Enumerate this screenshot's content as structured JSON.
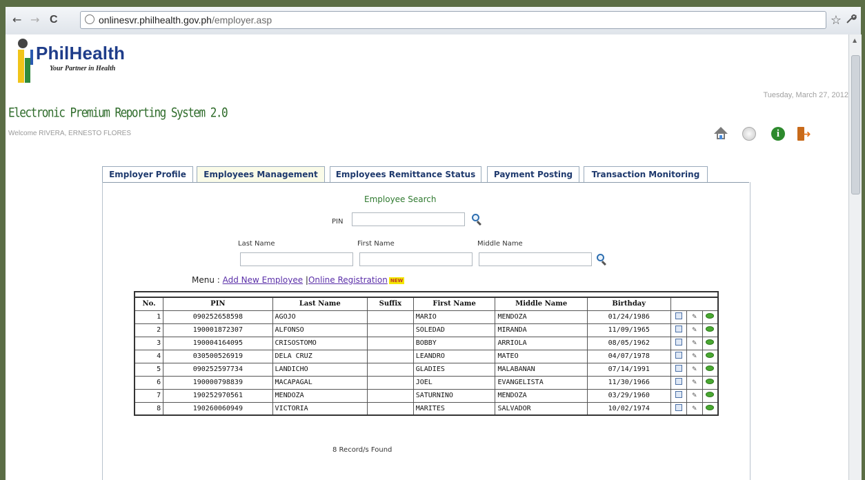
{
  "browser": {
    "back": "←",
    "forward": "→",
    "reload": "C",
    "url_host": "onlinesvr.philhealth.gov.ph",
    "url_path": "/employer.asp",
    "star": "☆",
    "wrench": "🔧"
  },
  "header": {
    "logo_name": "PhilHealth",
    "logo_tagline": "Your Partner in Health",
    "date": "Tuesday, March 27, 2012",
    "system_title": "Electronic Premium Reporting System 2.0",
    "welcome": "Welcome RIVERA, ERNESTO FLORES"
  },
  "toolbar_icons": [
    "home-icon",
    "clock-icon",
    "info-icon",
    "logout-icon"
  ],
  "tabs": [
    {
      "label": "Employer Profile"
    },
    {
      "label": "Employees Management"
    },
    {
      "label": "Employees Remittance Status"
    },
    {
      "label": "Payment Posting"
    },
    {
      "label": "Transaction Monitoring"
    }
  ],
  "search": {
    "title": "Employee Search",
    "pin_label": "PIN",
    "pin_value": "",
    "last_name_label": "Last Name",
    "first_name_label": "First Name",
    "middle_name_label": "Middle Name",
    "last_name_value": "",
    "first_name_value": "",
    "middle_name_value": ""
  },
  "menu": {
    "prefix": "Menu : ",
    "add_new": "Add New Employee",
    "separator": " |",
    "online_registration": "Online Registration",
    "new_badge": "NEW"
  },
  "table": {
    "headers": [
      "No.",
      "PIN",
      "Last Name",
      "Suffix",
      "First Name",
      "Middle Name",
      "Birthday"
    ],
    "rows": [
      {
        "no": "1",
        "pin": "090252658598",
        "last": "AGOJO",
        "suffix": "",
        "first": "MARIO",
        "middle": "MENDOZA",
        "birthday": "01/24/1986"
      },
      {
        "no": "2",
        "pin": "190001872307",
        "last": "ALFONSO",
        "suffix": "",
        "first": "SOLEDAD",
        "middle": "MIRANDA",
        "birthday": "11/09/1965"
      },
      {
        "no": "3",
        "pin": "190004164095",
        "last": "CRISOSTOMO",
        "suffix": "",
        "first": "BOBBY",
        "middle": "ARRIOLA",
        "birthday": "08/05/1962"
      },
      {
        "no": "4",
        "pin": "030500526919",
        "last": "DELA CRUZ",
        "suffix": "",
        "first": "LEANDRO",
        "middle": "MATEO",
        "birthday": "04/07/1978"
      },
      {
        "no": "5",
        "pin": "090252597734",
        "last": "LANDICHO",
        "suffix": "",
        "first": "GLADIES",
        "middle": "MALABANAN",
        "birthday": "07/14/1991"
      },
      {
        "no": "6",
        "pin": "190000798839",
        "last": "MACAPAGAL",
        "suffix": "",
        "first": "JOEL",
        "middle": "EVANGELISTA",
        "birthday": "11/30/1966"
      },
      {
        "no": "7",
        "pin": "190252970561",
        "last": "MENDOZA",
        "suffix": "",
        "first": "SATURNINO",
        "middle": "MENDOZA",
        "birthday": "03/29/1960"
      },
      {
        "no": "8",
        "pin": "190260060949",
        "last": "VICTORIA",
        "suffix": "",
        "first": "MARITES",
        "middle": "SALVADOR",
        "birthday": "10/02/1974"
      }
    ],
    "record_count": "8 Record/s Found"
  }
}
